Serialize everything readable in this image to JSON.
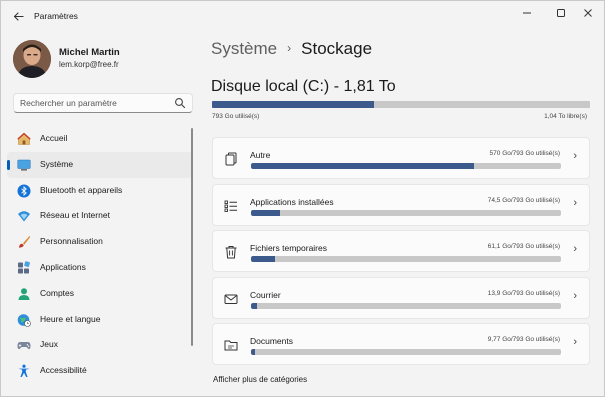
{
  "window": {
    "title": "Paramètres",
    "back_icon": "back-arrow-icon",
    "minimize_glyph": "—",
    "maximize_glyph": "☐",
    "close_glyph": "✕"
  },
  "profile": {
    "name": "Michel Martin",
    "email": "lem.korp@free.fr"
  },
  "search": {
    "placeholder": "Rechercher un paramètre"
  },
  "sidebar": {
    "active_index": 1,
    "accent": "#005fb8",
    "items": [
      {
        "label": "Accueil",
        "icon": "home-icon"
      },
      {
        "label": "Système",
        "icon": "system-monitor-icon"
      },
      {
        "label": "Bluetooth et appareils",
        "icon": "bluetooth-icon"
      },
      {
        "label": "Réseau et Internet",
        "icon": "network-icon"
      },
      {
        "label": "Personnalisation",
        "icon": "brush-icon"
      },
      {
        "label": "Applications",
        "icon": "apps-icon"
      },
      {
        "label": "Comptes",
        "icon": "account-icon"
      },
      {
        "label": "Heure et langue",
        "icon": "globe-clock-icon"
      },
      {
        "label": "Jeux",
        "icon": "gamepad-icon"
      },
      {
        "label": "Accessibilité",
        "icon": "accessibility-icon"
      }
    ]
  },
  "breadcrumb": {
    "parent": "Système",
    "separator": "›",
    "current": "Stockage"
  },
  "disk": {
    "title": "Disque local (C:) - 1,81 To",
    "used_label": "793 Go utilisé(s)",
    "free_label": "1,04 To libre(s)",
    "used_fraction": 0.428,
    "bar_color": "#3c5b8c"
  },
  "categories": [
    {
      "name": "Autre",
      "size": "570 Go/793 Go utilisé(s)",
      "fraction": 0.72,
      "icon": "other-files-icon"
    },
    {
      "name": "Applications installées",
      "size": "74,5 Go/793 Go utilisé(s)",
      "fraction": 0.094,
      "icon": "installed-apps-icon"
    },
    {
      "name": "Fichiers temporaires",
      "size": "61,1 Go/793 Go utilisé(s)",
      "fraction": 0.077,
      "icon": "trash-icon"
    },
    {
      "name": "Courrier",
      "size": "13,9 Go/793 Go utilisé(s)",
      "fraction": 0.018,
      "icon": "mail-icon"
    },
    {
      "name": "Documents",
      "size": "9,77 Go/793 Go utilisé(s)",
      "fraction": 0.012,
      "icon": "folder-icon"
    }
  ],
  "more_link": "Afficher plus de catégories"
}
